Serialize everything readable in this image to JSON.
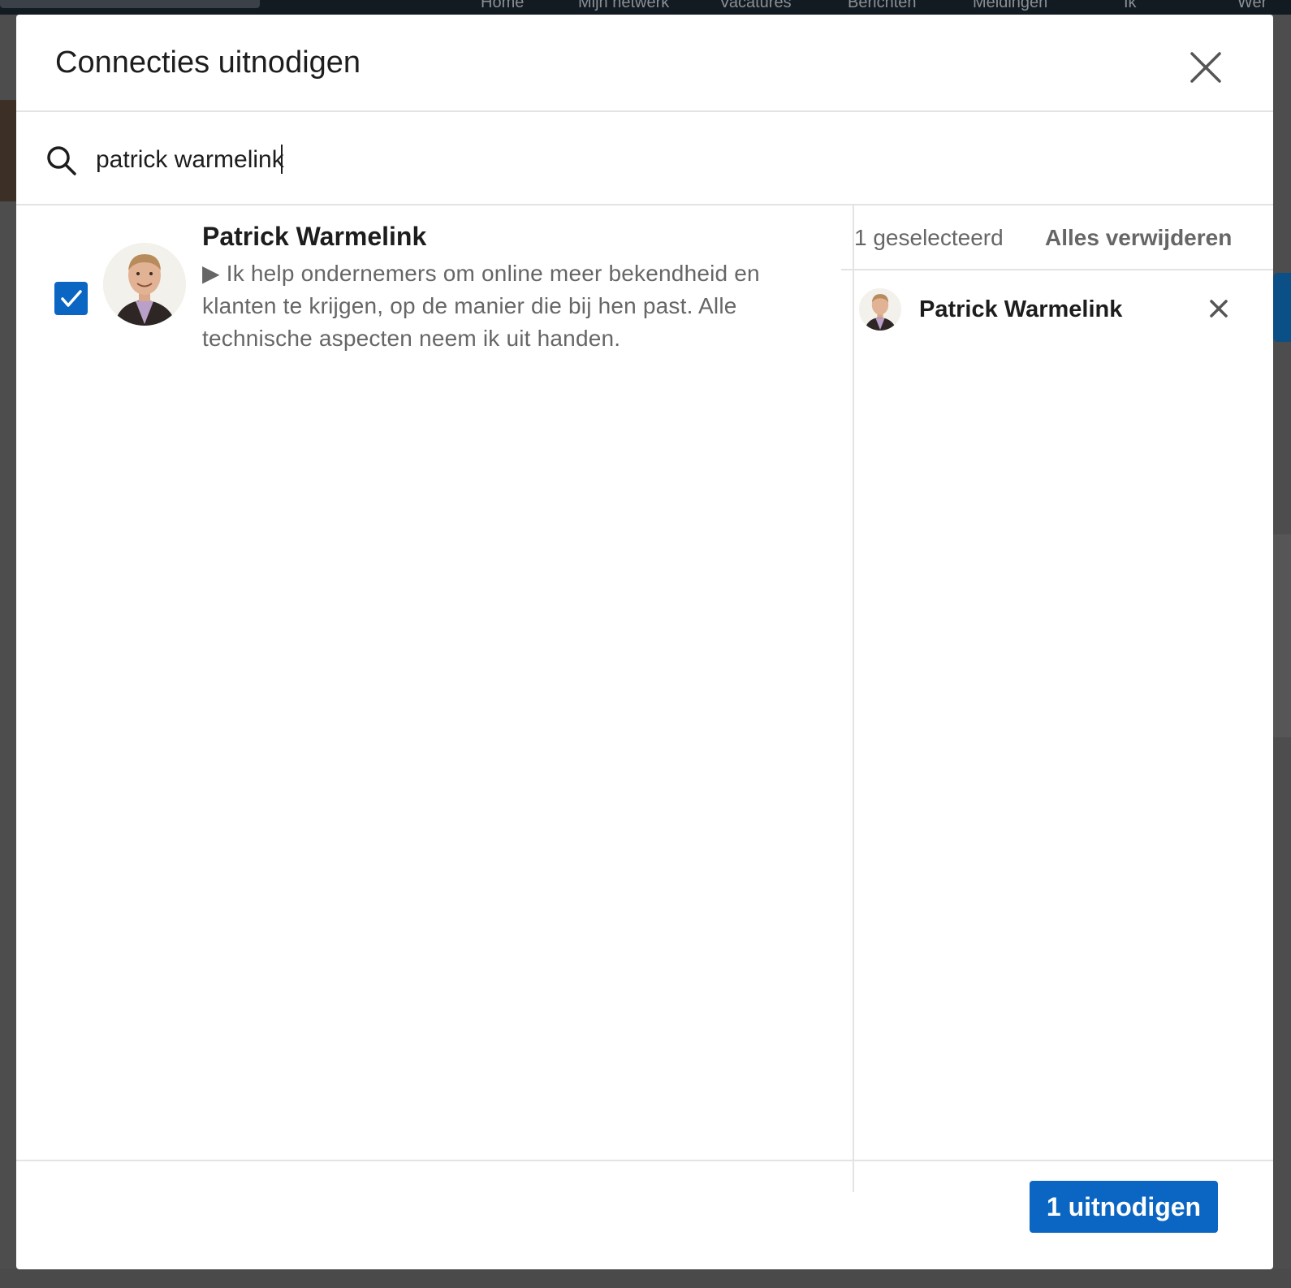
{
  "background_nav": {
    "items": [
      "Home",
      "Mijn netwerk",
      "Vacatures",
      "Berichten",
      "Meldingen",
      "Ik",
      "Wer"
    ]
  },
  "modal": {
    "title": "Connecties uitnodigen",
    "close_icon": "close-icon"
  },
  "search": {
    "icon": "search-icon",
    "value": "patrick warmelink"
  },
  "results": [
    {
      "name": "Patrick Warmelink",
      "headline": "▶ Ik help ondernemers om online meer bekendheid en klanten te krijgen, op de manier die bij hen past. Alle technische aspecten neem ik uit handen.",
      "checked": true
    }
  ],
  "selected": {
    "count_label": "1 geselecteerd",
    "remove_all_label": "Alles verwijderen",
    "items": [
      {
        "name": "Patrick Warmelink",
        "remove_icon": "close-icon"
      }
    ]
  },
  "footer": {
    "invite_label": "1 uitnodigen"
  },
  "colors": {
    "accent": "#0a66c2",
    "text_primary": "#1d1d1d",
    "text_secondary": "#666666",
    "divider": "#e3e3e3"
  }
}
